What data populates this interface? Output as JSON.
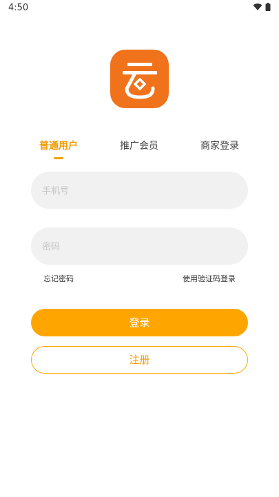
{
  "status_bar": {
    "time": "4:50"
  },
  "tabs": [
    {
      "label": "普通用户",
      "active": true
    },
    {
      "label": "推广会员",
      "active": false
    },
    {
      "label": "商家登录",
      "active": false
    }
  ],
  "form": {
    "phone_placeholder": "手机号",
    "phone_value": "",
    "password_placeholder": "密码",
    "password_value": "",
    "forgot_password": "忘记密码",
    "use_code_login": "使用验证码登录",
    "login_button": "登录",
    "register_button": "注册"
  },
  "colors": {
    "accent": "#ffa500",
    "logo_bg": "#f0731c"
  }
}
